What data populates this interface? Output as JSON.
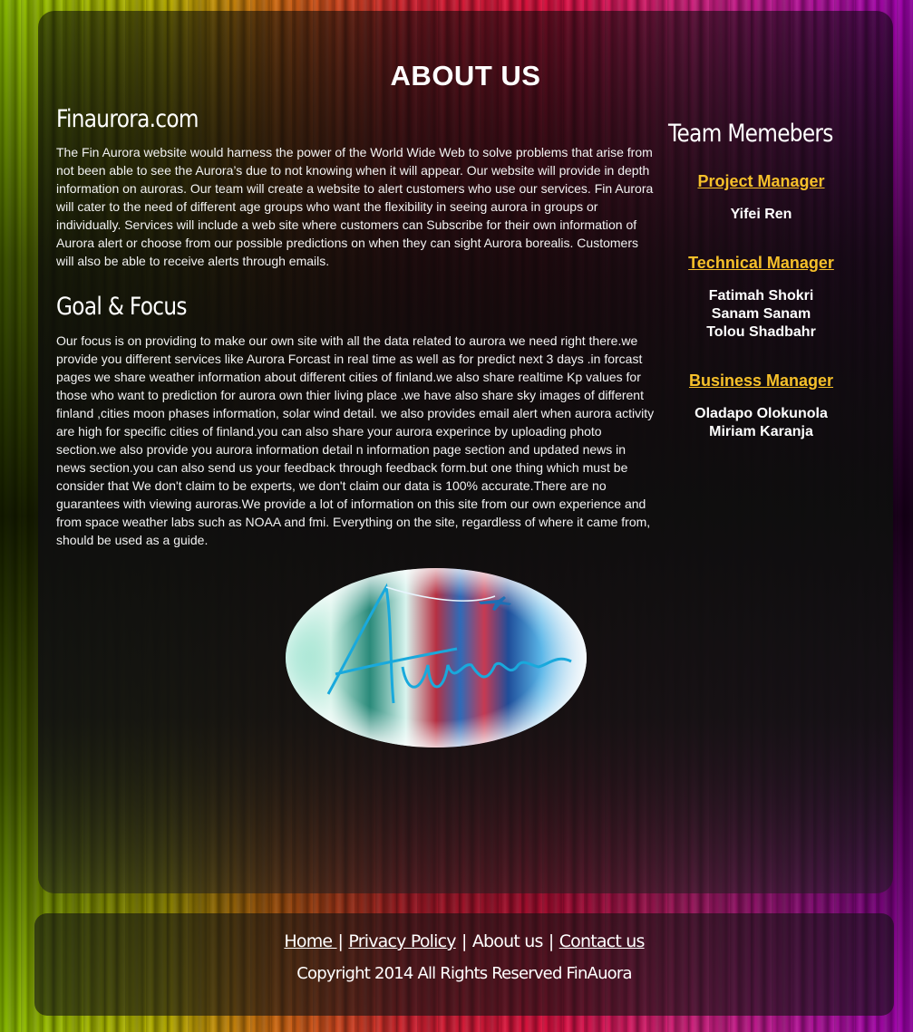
{
  "page_title": "ABOUT US",
  "intro": {
    "heading": "Finaurora.com",
    "text": "The Fin Aurora website would harness the power of the World Wide Web to solve problems that arise from not been able to see the Aurora’s due to not knowing when it will appear. Our website will provide in depth information on auroras. Our team will create a website to  alert customers who use our services. Fin Aurora will cater to the need of different age groups who want the flexibility in seeing aurora in groups or individually. Services will include a web site where customers can Subscribe   for their own information of Aurora alert  or choose  from our possible predictions on when they  can sight Aurora borealis. Customers will also be able to receive alerts through emails."
  },
  "goal": {
    "heading": "Goal & Focus",
    "text": "Our focus is on providing to make our own site with all the data related to aurora we need right there.we provide you different services like Aurora Forcast in real time as well as for predict next 3 days .in forcast pages we share weather information about different cities of finland.we also share realtime Kp values for those who want to prediction for aurora own thier living place .we have also share sky images of different finland ,cities moon phases information, solar wind detail. we also provides email alert when aurora activity are high for specific cities of finland.you can also share your aurora experince by uploading photo section.we also provide you aurora information detail n information page section and updated news in news section.you can also send us your feedback through feedback form.but one thing which must be consider that We don't claim to be experts, we don't claim our data is 100% accurate.There are no guarantees with viewing auroras.We provide a lot of information on this site from our own experience and from space weather labs such as NOAA and fmi. Everything on the site, regardless of where it came from, should be used as a guide."
  },
  "team": {
    "title": "Team Memebers",
    "roles": [
      {
        "role": "Project Manager",
        "members": [
          "Yifei Ren"
        ]
      },
      {
        "role": "Technical Manager",
        "members": [
          "Fatimah Shokri",
          "Sanam Sanam",
          "Tolou Shadbahr"
        ]
      },
      {
        "role": "Business Manager",
        "members": [
          "Oladapo Olokunola",
          "Miriam Karanja"
        ]
      }
    ]
  },
  "logo": {
    "text": "Aurora",
    "icon": "airplane-icon"
  },
  "footer": {
    "links": [
      "Home ",
      "Privacy Policy",
      "About us",
      "Contact us"
    ],
    "separator": "|",
    "copyright": "Copyright 2014 All Rights Reserved FinAuora"
  },
  "colors": {
    "accent": "#f6c02a",
    "text": "#ffffff"
  }
}
